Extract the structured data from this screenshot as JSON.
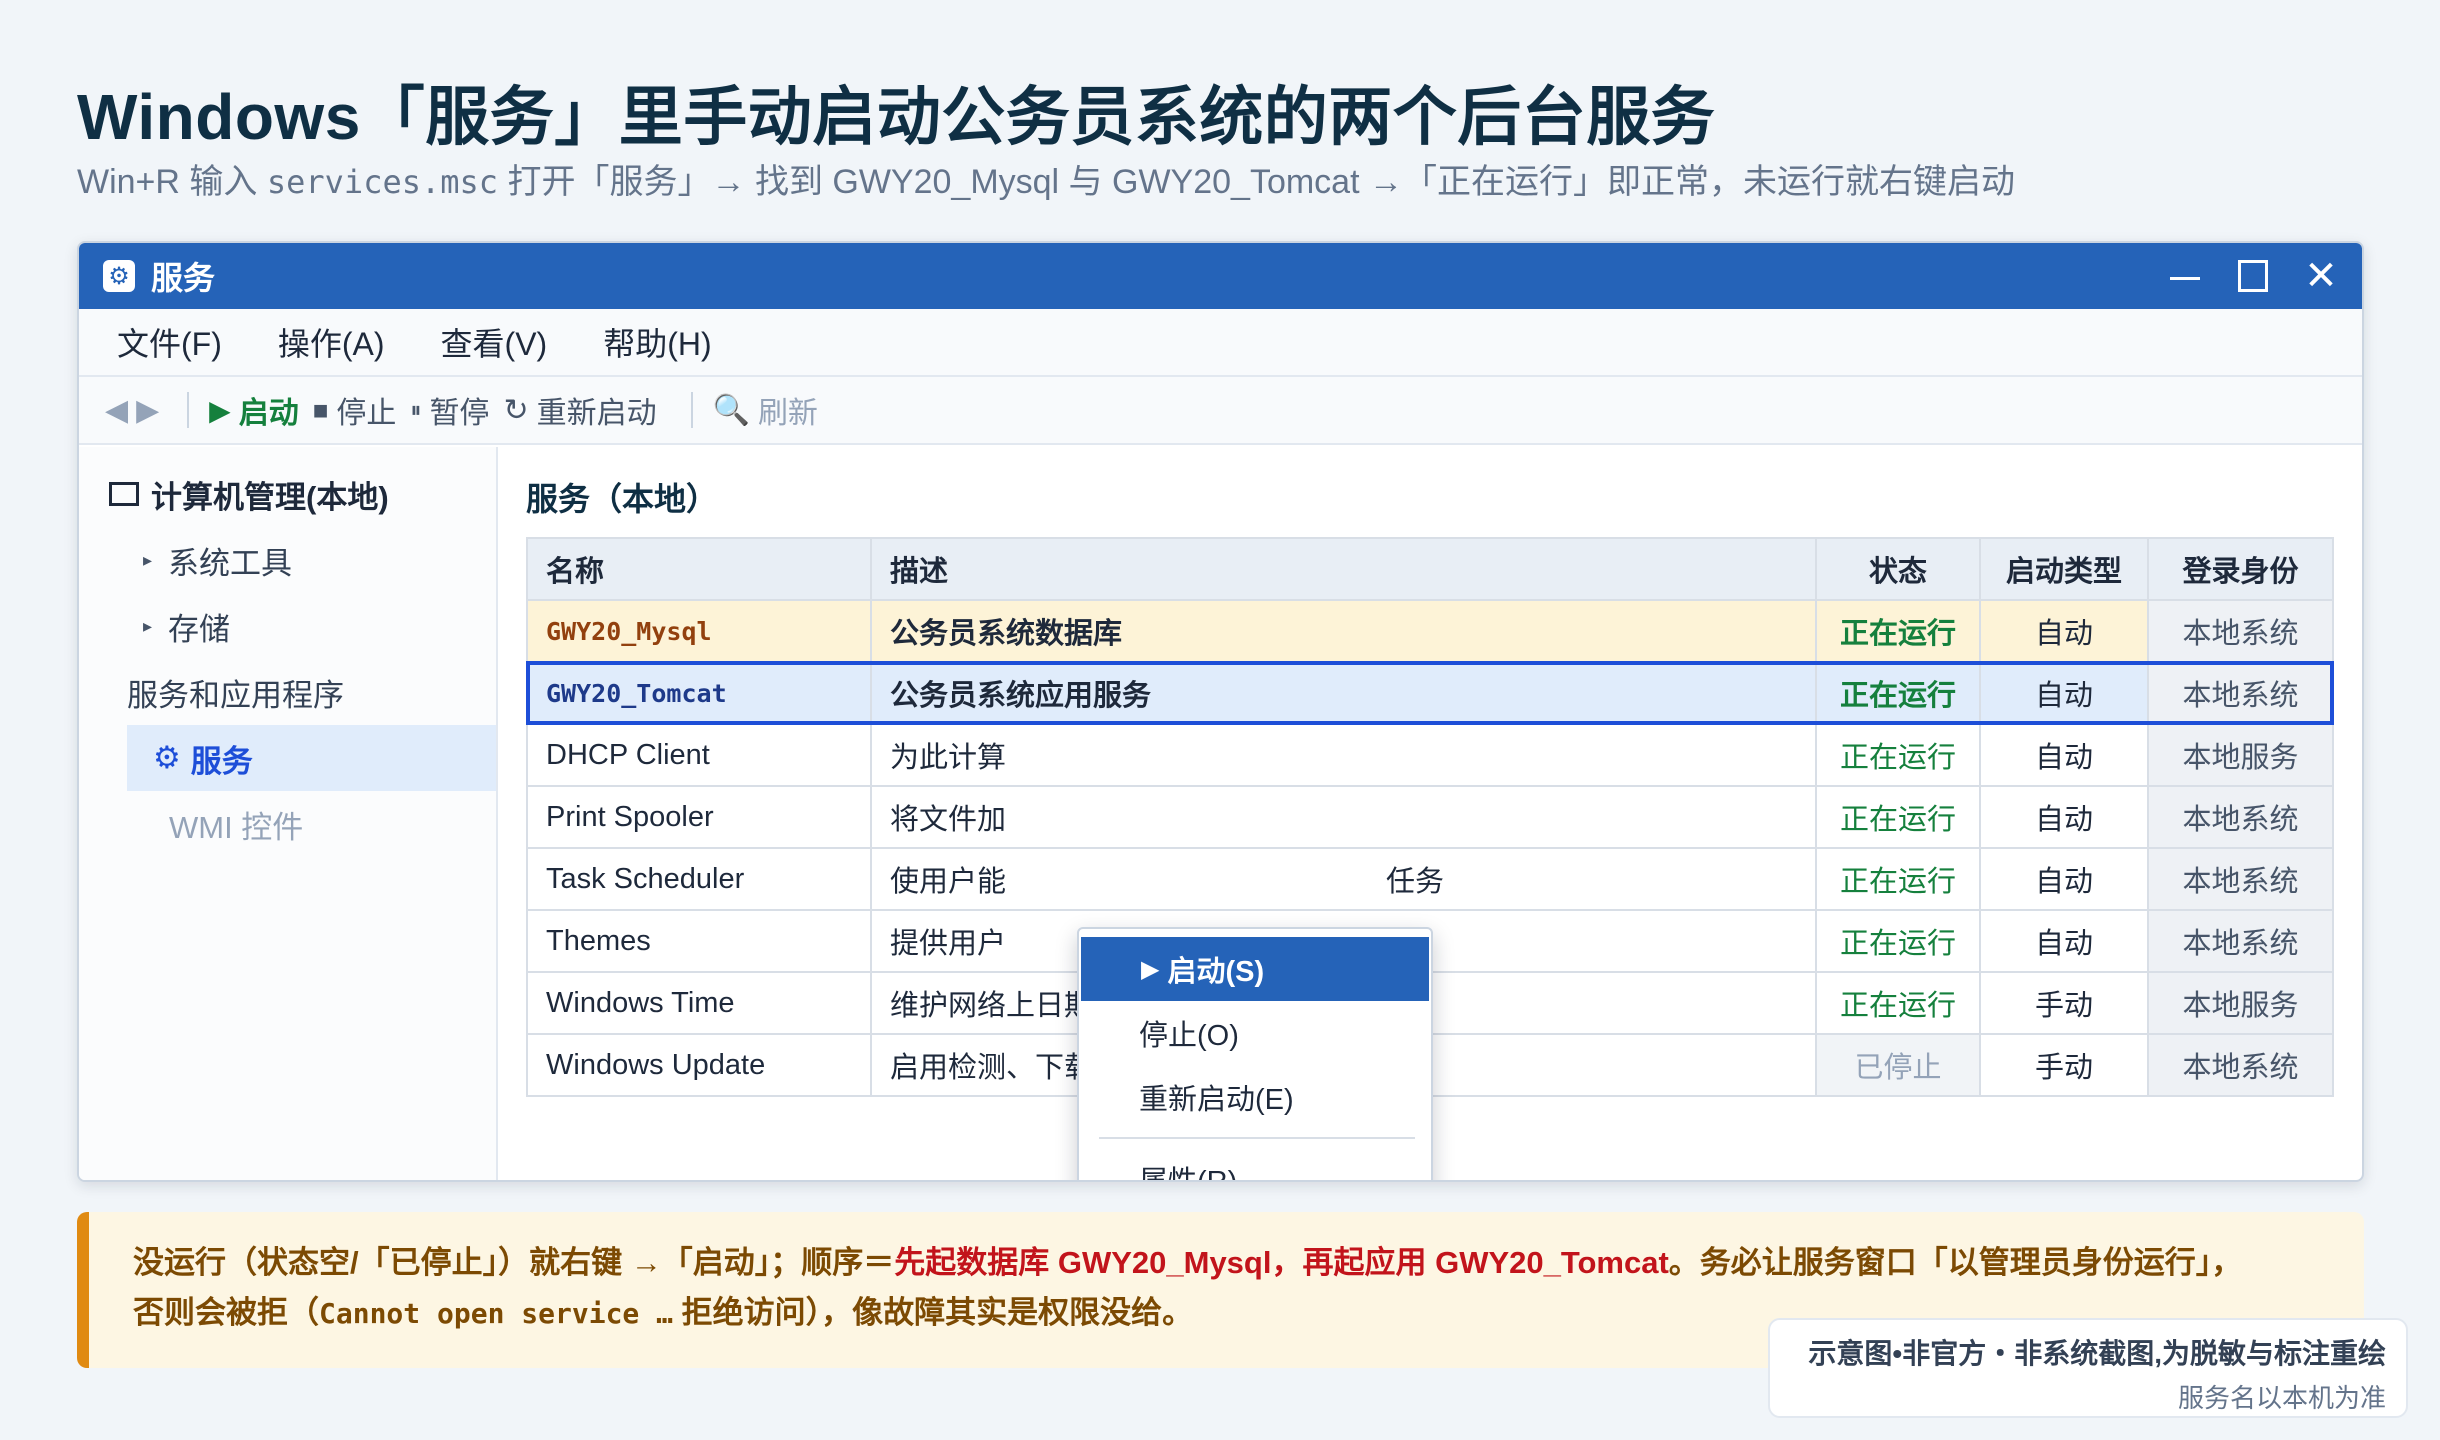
{
  "page": {
    "title": "Windows「服务」里手动启动公务员系统的两个后台服务",
    "subtitle_pre": "Win+R 输入 ",
    "subtitle_cmd": "services.msc",
    "subtitle_post": " 打开「服务」→ 找到 GWY20_Mysql 与 GWY20_Tomcat →「正在运行」即正常，未运行就右键启动"
  },
  "window": {
    "title": "服务",
    "icon": "gear-icon",
    "accent_color": "#2563b8",
    "menu": [
      "文件(F)",
      "操作(A)",
      "查看(V)",
      "帮助(H)"
    ],
    "toolbar": {
      "back": "◀",
      "forward": "▶",
      "start": "启动",
      "stop": "停止",
      "pause": "暂停",
      "restart": "重新启动",
      "refresh": "刷新"
    }
  },
  "tree": {
    "root": "计算机管理(本地)",
    "items": [
      "系统工具",
      "存储",
      "服务和应用程序",
      "服务",
      "WMI 控件"
    ]
  },
  "pane": {
    "title": "服务（本地）",
    "columns": [
      "名称",
      "描述",
      "状态",
      "启动类型",
      "登录身份"
    ],
    "rows": [
      {
        "name": "GWY20_Mysql",
        "desc": "公务员系统数据库",
        "status": "正在运行",
        "type": "自动",
        "logon": "本地系统"
      },
      {
        "name": "GWY20_Tomcat",
        "desc": "公务员系统应用服务",
        "status": "正在运行",
        "type": "自动",
        "logon": "本地系统"
      },
      {
        "name": "DHCP Client",
        "desc": "为此计算",
        "status": "正在运行",
        "type": "自动",
        "logon": "本地服务"
      },
      {
        "name": "Print Spooler",
        "desc": "将文件加",
        "status": "正在运行",
        "type": "自动",
        "logon": "本地系统"
      },
      {
        "name": "Task Scheduler",
        "desc": "使用户能",
        "desc_tail": "任务",
        "status": "正在运行",
        "type": "自动",
        "logon": "本地系统"
      },
      {
        "name": "Themes",
        "desc": "提供用户",
        "status": "正在运行",
        "type": "自动",
        "logon": "本地系统"
      },
      {
        "name": "Windows Time",
        "desc": "维护网络上日期和时间的同步",
        "status": "正在运行",
        "type": "手动",
        "logon": "本地服务"
      },
      {
        "name": "Windows Update",
        "desc": "启用检测、下载和安装 Windows 更新",
        "status": "已停止",
        "type": "手动",
        "logon": "本地系统"
      }
    ]
  },
  "context_menu": {
    "items": [
      "启动(S)",
      "停止(O)",
      "重新启动(E)",
      "属性(R)"
    ]
  },
  "note": {
    "p1": "没运行（状态空/「已停止」）就右键 →「启动」；顺序＝",
    "p2_red": "先起数据库 GWY20_Mysql，再起应用 GWY20_Tomcat",
    "p3": "。务必让服务窗口「以管理员身份运行」，",
    "p4": "否则会被拒（",
    "p5_mono": "Cannot open service …",
    "p6": " 拒绝访问），像故障其实是权限没给。"
  },
  "watermark": {
    "line1": "示意图•非官方・非系统截图,为脱敏与标注重绘",
    "line2": "服务名以本机为准"
  }
}
